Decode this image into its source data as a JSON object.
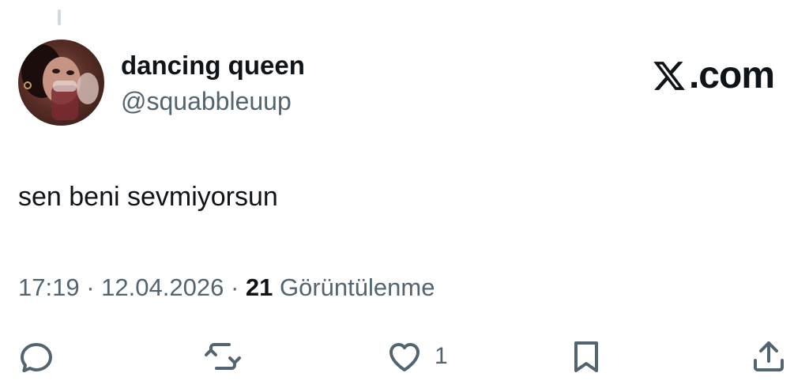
{
  "author": {
    "display_name": "dancing queen",
    "handle": "@squabbleuup"
  },
  "brand": {
    "label": ".com"
  },
  "tweet": {
    "text": "sen beni sevmiyorsun",
    "time": "17:19",
    "separator": "·",
    "date": "12.04.2026",
    "views_count": "21",
    "views_label": "Görüntülenme"
  },
  "actions": {
    "like_count": "1"
  },
  "icons": {
    "reply": "reply-icon",
    "retweet": "retweet-icon",
    "like": "heart-icon",
    "bookmark": "bookmark-icon",
    "share": "share-icon"
  },
  "colors": {
    "text": "#0f1419",
    "secondary": "#536471",
    "thread_line": "#cfd9de",
    "background": "#ffffff"
  }
}
